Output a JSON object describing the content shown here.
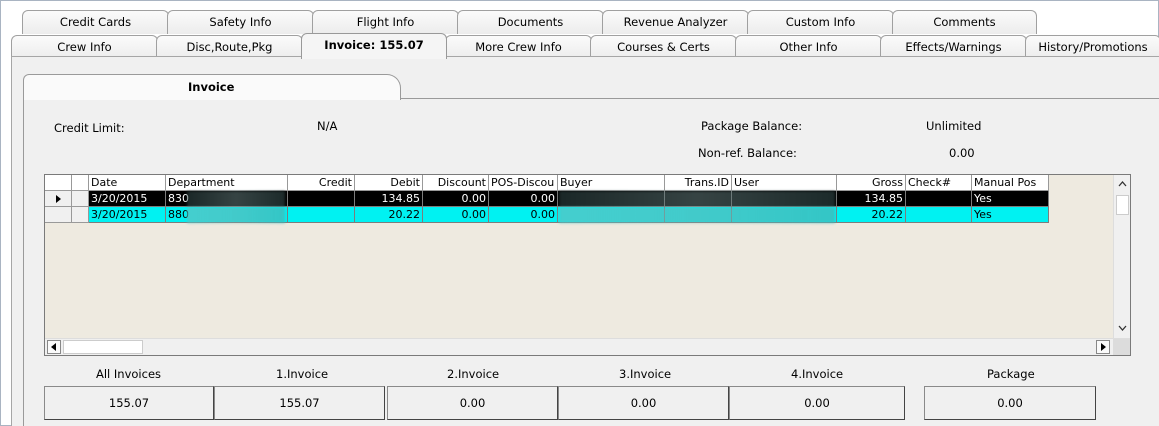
{
  "tabs_row1": [
    "Credit Cards",
    "Safety Info",
    "Flight Info",
    "Documents",
    "Revenue Analyzer",
    "Custom Info",
    "Comments"
  ],
  "tabs_row2": [
    "Crew Info",
    "Disc,Route,Pkg",
    "Invoice: 155.07",
    "More Crew Info",
    "Courses & Certs",
    "Other Info",
    "Effects/Warnings",
    "History/Promotions"
  ],
  "subtab": "Invoice",
  "summary": {
    "credit_limit_label": "Credit Limit:",
    "credit_limit_value": "N/A",
    "package_balance_label": "Package Balance:",
    "package_balance_value": "Unlimited",
    "nonref_balance_label": "Non-ref. Balance:",
    "nonref_balance_value": "0.00"
  },
  "grid": {
    "columns": [
      "Date",
      "Department",
      "Credit",
      "Debit",
      "Discount",
      "POS-Discou",
      "Buyer",
      "Trans.ID",
      "User",
      "Gross",
      "Check#",
      "Manual Pos"
    ],
    "rows": [
      {
        "date": "3/20/2015",
        "department": "830",
        "credit": "",
        "debit": "134.85",
        "discount": "0.00",
        "pos_discount": "0.00",
        "buyer": "",
        "trans_id": "",
        "user": "",
        "gross": "134.85",
        "check": "",
        "manual_pos": "Yes"
      },
      {
        "date": "3/20/2015",
        "department": "880",
        "credit": "",
        "debit": "20.22",
        "discount": "0.00",
        "pos_discount": "0.00",
        "buyer": "",
        "trans_id": "",
        "user": "",
        "gross": "20.22",
        "check": "",
        "manual_pos": "Yes"
      }
    ]
  },
  "footer": {
    "labels": [
      "All Invoices",
      "1.Invoice",
      "2.Invoice",
      "3.Invoice",
      "4.Invoice",
      "Package"
    ],
    "values": [
      "155.07",
      "155.07",
      "0.00",
      "0.00",
      "0.00",
      "0.00"
    ]
  },
  "icons": {
    "row_pointer": "row-pointer-icon",
    "scroll_up": "chevron-up-icon",
    "scroll_down": "chevron-down-icon",
    "scroll_left": "chevron-left-icon",
    "scroll_right": "chevron-right-icon"
  },
  "colors": {
    "selected_row_bg": "#000000",
    "highlight_row_bg": "#00f2f2",
    "grid_bg": "#eeeae0"
  }
}
